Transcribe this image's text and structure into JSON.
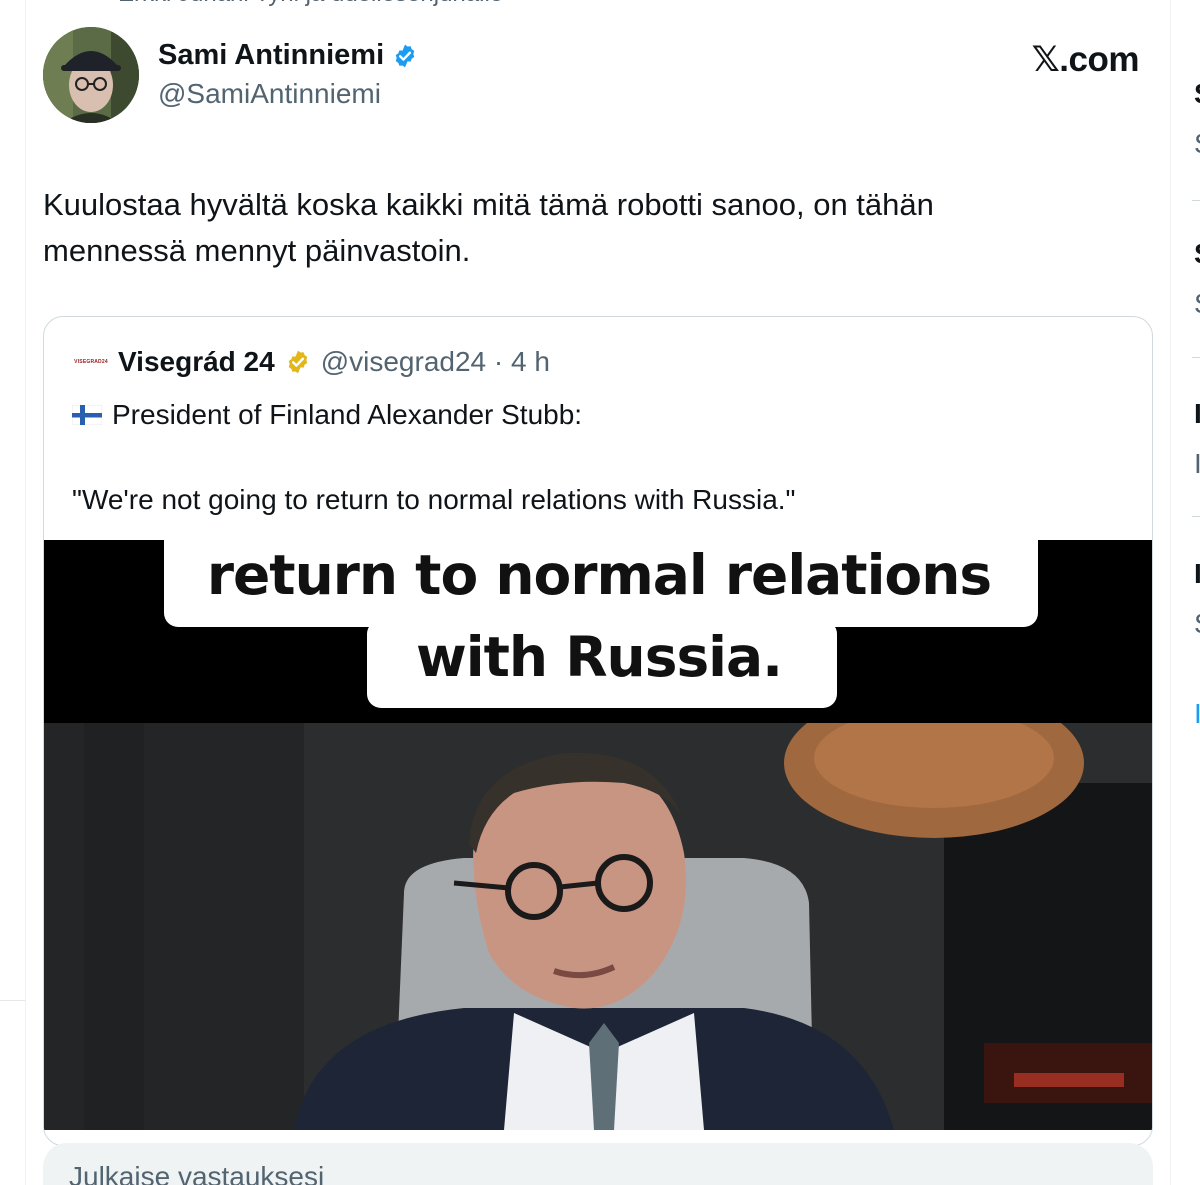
{
  "reply_context": "Erkki Juhani Tyni ja udeliesenjuhalle",
  "author": {
    "name": "Sami Antinniemi",
    "handle": "@SamiAntinniemi",
    "verified_color": "#1d9bf0",
    "avatar_icon": "avatar-photo"
  },
  "brand": "𝕏.com",
  "tweet": {
    "text_line1": "Kuulostaa hyvältä koska kaikki mitä tämä robotti sanoo, on tähän",
    "text_line2": "mennessä mennyt päinvastoin."
  },
  "quote": {
    "logo_text": "VISEGRAD24",
    "name": "Visegrád 24",
    "verified_color": "#e2b719",
    "handle_time": "@visegrad24 · 4 h",
    "line1_flag": "finland-flag-icon",
    "line1": "President of Finland Alexander Stubb:",
    "line2": "\"We're not going to return to normal relations with Russia.\"",
    "media": {
      "caption_line1": "return to normal relations",
      "caption_line2": "with Russia."
    }
  },
  "reply_box": {
    "placeholder": "Julkaise vastauksesi"
  },
  "right_column_letters": [
    "S",
    "S",
    "S",
    "S",
    "I",
    "I",
    "I",
    "S"
  ]
}
